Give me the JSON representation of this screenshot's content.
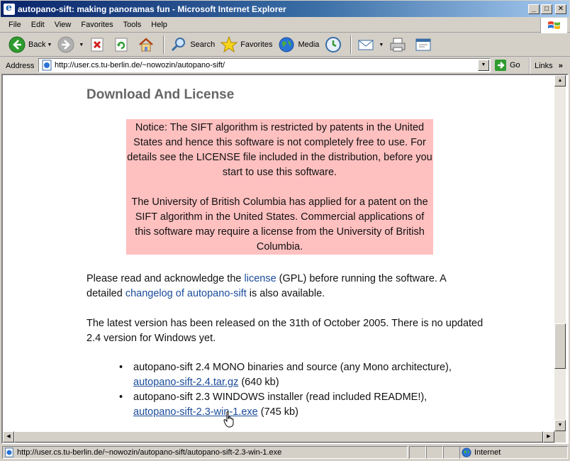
{
  "window": {
    "title": "autopano-sift: making panoramas fun - Microsoft Internet Explorer",
    "app_icon": "ie-icon",
    "controls": [
      "minimize",
      "maximize",
      "close"
    ]
  },
  "menubar": {
    "items": [
      {
        "label": "File"
      },
      {
        "label": "Edit"
      },
      {
        "label": "View"
      },
      {
        "label": "Favorites"
      },
      {
        "label": "Tools"
      },
      {
        "label": "Help"
      }
    ]
  },
  "toolbar": {
    "back_label": "Back",
    "search_label": "Search",
    "favorites_label": "Favorites",
    "media_label": "Media"
  },
  "address": {
    "label": "Address",
    "url": "http://user.cs.tu-berlin.de/~nowozin/autopano-sift/",
    "go_label": "Go",
    "links_label": "Links",
    "links_chevron": "»"
  },
  "page": {
    "heading": "Download And License",
    "notice_p1": "Notice: The SIFT algorithm is restricted by patents in the United States and hence this software is not completely free to use. For details see the LICENSE file included in the distribution, before you start to use this software.",
    "notice_p2": "The University of British Columbia has applied for a patent on the SIFT algorithm in the United States. Commercial applications of this software may require a license from the University of British Columbia.",
    "para1": {
      "before": "Please read and acknowledge the ",
      "link_license": "license",
      "middle": " (GPL) before running the software. A detailed ",
      "link_changelog": "changelog of autopano-sift",
      "after": " is also available."
    },
    "para2": "The latest version has been released on the 31th of October 2005. There is no updated 2.4 version for Windows yet.",
    "downloads": [
      {
        "text": "autopano-sift 2.4 MONO binaries and source (any Mono architecture),",
        "link": "autopano-sift-2.4.tar.gz",
        "size": " (640 kb)"
      },
      {
        "text": "autopano-sift 2.3 WINDOWS installer (read included README!),",
        "link": "autopano-sift-2.3-win-1.exe",
        "size": " (745 kb)"
      }
    ]
  },
  "statusbar": {
    "text": "http://user.cs.tu-berlin.de/~nowozin/autopano-sift/autopano-sift-2.3-win-1.exe",
    "zone": "Internet"
  },
  "colors": {
    "title_gradient_start": "#0a246a",
    "title_gradient_end": "#a6caf0",
    "notice_bg": "#ffc0c0",
    "link": "#1a4b99",
    "heading": "#666666"
  }
}
